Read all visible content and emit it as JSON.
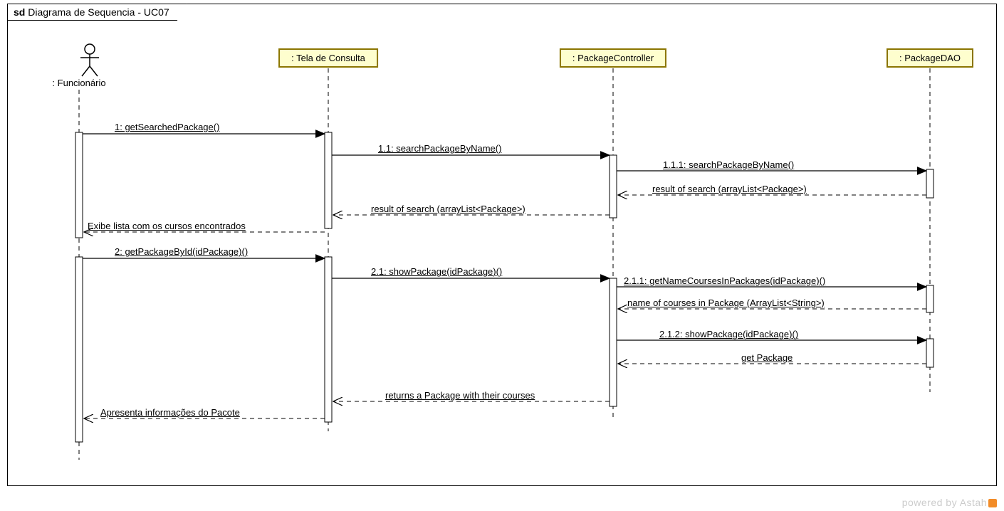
{
  "frame": {
    "prefix": "sd",
    "title": "Diagrama de Sequencia - UC07"
  },
  "participants": {
    "actor": ": Funcionário",
    "p1": ": Tela de Consulta",
    "p2": ": PackageController",
    "p3": ": PackageDAO"
  },
  "messages": {
    "m1": "1: getSearchedPackage()",
    "m11": "1.1: searchPackageByName()",
    "m111": "1.1.1: searchPackageByName()",
    "r111": "result of search (arrayList<Package>)",
    "r11": "result of search (arrayList<Package>)",
    "r1": "Exibe lista com os cursos encontrados",
    "m2": "2: getPackageById(idPackage)()",
    "m21": "2.1: showPackage(idPackage)()",
    "m211": "2.1.1: getNameCoursesInPackages(idPackage)()",
    "r211": "name of courses in Package (ArrayList<String>)",
    "m212": "2.1.2: showPackage(idPackage)()",
    "r212": "get Package",
    "r21": "returns a Package with their courses",
    "r2": "Apresenta informações do Pacote"
  },
  "watermark": "powered by Astah"
}
